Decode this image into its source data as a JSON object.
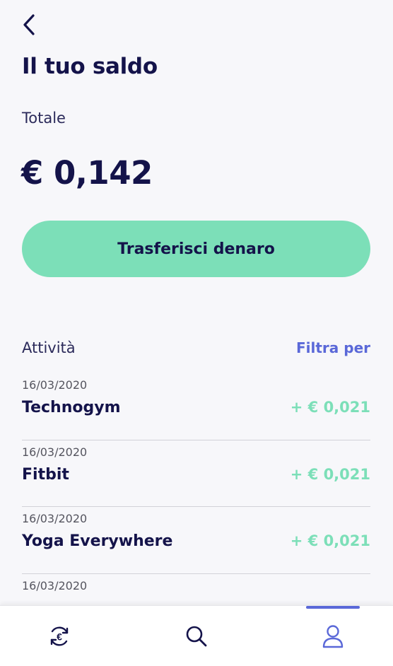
{
  "header": {
    "title": "Il tuo saldo"
  },
  "balance": {
    "label": "Totale",
    "amount": "€ 0,142"
  },
  "actions": {
    "transfer_label": "Trasferisci denaro"
  },
  "activity": {
    "title": "Attività",
    "filter_label": "Filtra per",
    "items": [
      {
        "date": "16/03/2020",
        "name": "Technogym",
        "amount": "+ € 0,021"
      },
      {
        "date": "16/03/2020",
        "name": "Fitbit",
        "amount": "+ € 0,021"
      },
      {
        "date": "16/03/2020",
        "name": "Yoga Everywhere",
        "amount": "+ € 0,021"
      },
      {
        "date": "16/03/2020"
      }
    ]
  },
  "tab_bar": {
    "tabs": [
      {
        "icon": "euro-exchange-icon",
        "active": false
      },
      {
        "icon": "search-icon",
        "active": false
      },
      {
        "icon": "profile-icon",
        "active": true
      }
    ]
  },
  "colors": {
    "primary_text": "#14134a",
    "accent_green": "#7cdfb8",
    "accent_blue": "#5a68d8",
    "background": "#f7f7fa"
  }
}
